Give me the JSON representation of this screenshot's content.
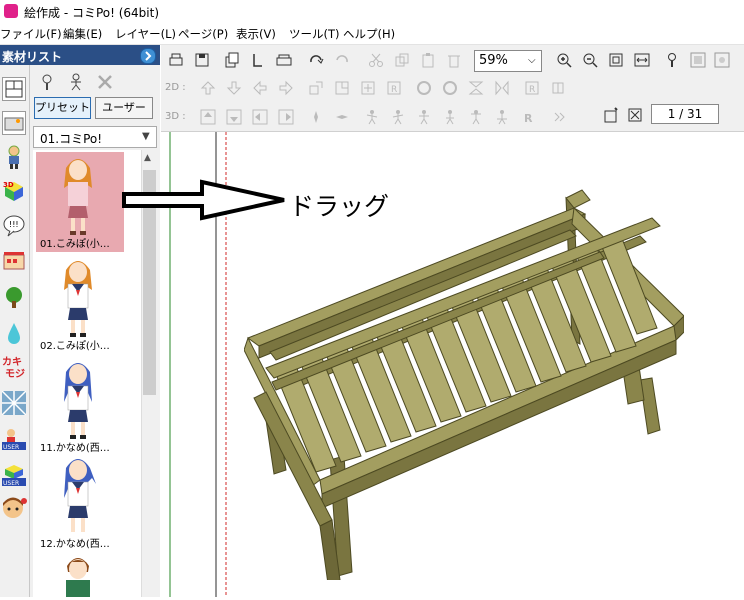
{
  "window": {
    "title": "絵作成 - コミPo! (64bit)"
  },
  "menu": [
    "ファイル(F)",
    "編集(E)",
    "レイヤー(L)",
    "ページ(P)",
    "表示(V)",
    "ツール(T)",
    "ヘルプ(H)"
  ],
  "panel": {
    "title": "素材リスト",
    "tabs": [
      "プリセット",
      "ユーザー"
    ],
    "selected_set": "01.コミPo!",
    "items": [
      {
        "label": "01.こみぽ(小…",
        "selected": true
      },
      {
        "label": "02.こみぽ(小…",
        "selected": false
      },
      {
        "label": "11.かなめ(西…",
        "selected": false
      },
      {
        "label": "12.かなめ(西…",
        "selected": false
      }
    ]
  },
  "toolbar": {
    "zoom": "59%",
    "row2_label": "2D :",
    "row3_label": "3D :",
    "page_indicator": "1 / 31"
  },
  "canvas": {
    "annotation": "ドラッグ"
  },
  "colors": {
    "panel_header": "#2b4f86",
    "selected_item": "#e8a9b0",
    "bed": "#7a7540"
  },
  "icons": {
    "category": [
      "frame-icon",
      "background-icon",
      "character-icon",
      "3d-object-icon",
      "balloon-icon",
      "scene-icon",
      "tree-icon",
      "drop-icon",
      "text-icon",
      "effect-icon",
      "user-character-icon",
      "user-3d-icon",
      "user-face-icon"
    ]
  }
}
